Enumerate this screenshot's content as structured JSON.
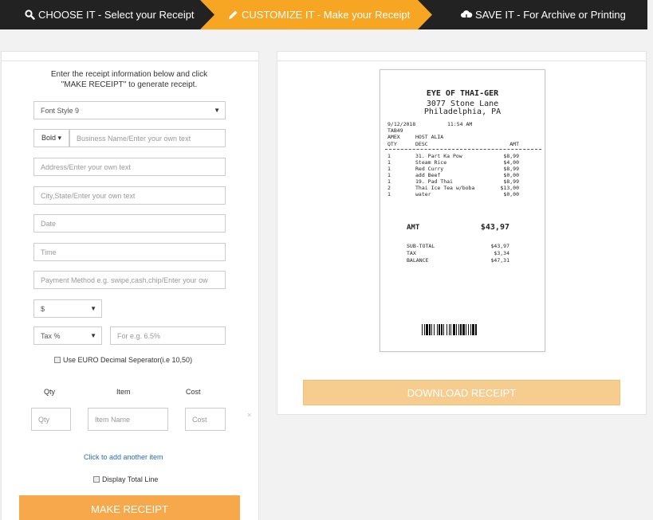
{
  "steps": [
    {
      "label": "CHOOSE IT - Select your Receipt",
      "icon": "search-icon"
    },
    {
      "label": "CUSTOMIZE IT - Make your Receipt",
      "icon": "pencil-icon"
    },
    {
      "label": "SAVE IT - For Archive or Printing",
      "icon": "cloud-download-icon"
    }
  ],
  "form": {
    "intro_line1": "Enter the receipt information below and click",
    "intro_line2": "\"MAKE RECEIPT\" to generate receipt.",
    "font_style": "Font Style 9",
    "bold_label": "Bold ▾",
    "business_name_placeholder": "Business Name/Enter your own text",
    "address_placeholder": "Address/Enter your own text",
    "city_placeholder": "City,State/Enter your own text",
    "date_placeholder": "Date",
    "time_placeholder": "Time",
    "payment_placeholder": "Payment Method e.g. swipe,cash,chip/Enter your ow",
    "currency": "$",
    "tax_select": "Tax %",
    "tax_placeholder": "For e.g. 6.5%",
    "euro_label": "Use EURO Decimal Seperator(i.e 10,50)",
    "col_qty": "Qty",
    "col_item": "Item",
    "col_cost": "Cost",
    "qty_placeholder": "Qty",
    "item_placeholder": "Item Name",
    "cost_placeholder": "Cost",
    "remove_label": "×",
    "add_item_link": "Click to add another item",
    "total_line_label": "Display Total Line",
    "make_button": "MAKE RECEIPT"
  },
  "receipt": {
    "business": "EYE OF THAI-GER",
    "address": "3077 Stone Lane",
    "city": "Philadelphia, PA",
    "date": "9/12/2018",
    "time": "11:54 AM",
    "tab": "TAB49",
    "payment": "AMEX",
    "host": "HOST ALIA",
    "hdr_qty": "QTY",
    "hdr_desc": "DESC",
    "hdr_amt": "AMT",
    "items": [
      {
        "qty": "1",
        "desc": "31. Part Ka Pow",
        "amt": "$8,99"
      },
      {
        "qty": "1",
        "desc": "Steam Rice",
        "amt": "$4,00"
      },
      {
        "qty": "1",
        "desc": "Red Curry",
        "amt": "$8,99"
      },
      {
        "qty": "1",
        "desc": "add Beef",
        "amt": "$0,00"
      },
      {
        "qty": "1",
        "desc": "19. Pad Thai",
        "amt": "$8,99"
      },
      {
        "qty": "2",
        "desc": "Thai Ice Tea w/boba",
        "amt": "$13,00"
      },
      {
        "qty": "1",
        "desc": "water",
        "amt": "$0,00"
      }
    ],
    "amt_label": "AMT",
    "amt_value": "$43,97",
    "subtotal_label": "SUB-TOTAL",
    "subtotal_value": "$43,97",
    "tax_label": "TAX",
    "tax_value": "$3,34",
    "balance_label": "BALANCE",
    "balance_value": "$47,31"
  },
  "download_button": "DOWNLOAD RECEIPT",
  "colors": {
    "accent": "#f6a623",
    "bar": "#222222",
    "download": "#f6cd8e",
    "make": "#f6a84a"
  }
}
